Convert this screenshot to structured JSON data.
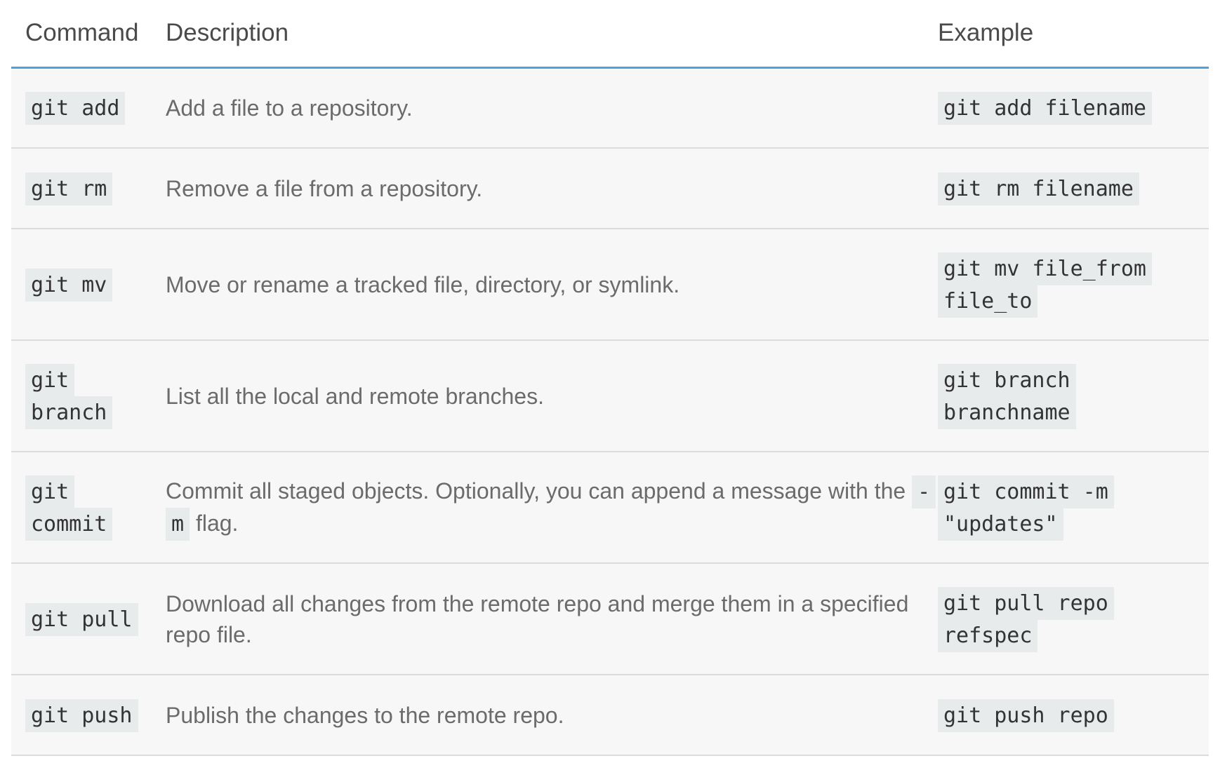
{
  "table": {
    "headers": {
      "command": "Command",
      "description": "Description",
      "example": "Example"
    },
    "rows": [
      {
        "command": "git add",
        "description": "Add a file to a repository.",
        "example": "git add filename"
      },
      {
        "command": "git rm",
        "description": "Remove a file from a repository.",
        "example": "git rm filename"
      },
      {
        "command": "git mv",
        "description": "Move or rename a tracked file, directory, or symlink.",
        "example": "git mv file_from file_to"
      },
      {
        "command": "git branch",
        "description": "List all the local and remote branches.",
        "example": "git branch branchname"
      },
      {
        "command": "git commit",
        "description_before": "Commit all staged objects. Optionally, you can append a message with the",
        "description_code": "-m",
        "description_after": "flag.",
        "example": "git commit -m \"updates\""
      },
      {
        "command": "git pull",
        "description": "Download all changes from the remote repo and merge them in a specified repo file.",
        "example": "git pull repo refspec"
      },
      {
        "command": "git push",
        "description": "Publish the changes to the remote repo.",
        "example": "git push repo"
      }
    ]
  }
}
